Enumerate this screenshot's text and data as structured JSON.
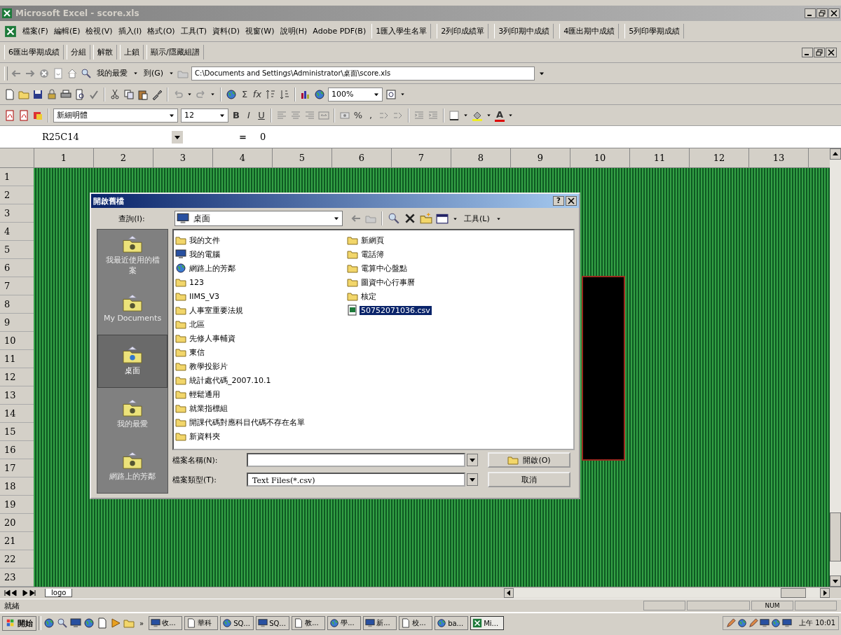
{
  "window": {
    "title": "Microsoft Excel - score.xls"
  },
  "menu_bar": {
    "items": [
      "檔案(F)",
      "編輯(E)",
      "檢視(V)",
      "插入(I)",
      "格式(O)",
      "工具(T)",
      "資料(D)",
      "視窗(W)",
      "說明(H)",
      "Adobe PDF(B)"
    ],
    "custom_buttons": [
      "1匯入學生名單",
      "2列印成績單",
      "3列印期中成績",
      "4匯出期中成績",
      "5列印學期成績"
    ]
  },
  "custom_toolbar": {
    "items": [
      "6匯出學期成績",
      "分組",
      "解散",
      "上鎖",
      "顯示/隱藏組譜"
    ]
  },
  "web_toolbar": {
    "favorites": "我的最愛",
    "go": "到(G)",
    "address": "C:\\Documents and Settings\\Administrator\\桌面\\score.xls"
  },
  "standard_toolbar": {
    "sum": "Σ",
    "function": "fx",
    "zoom": "100%"
  },
  "formatting_toolbar": {
    "font": "新細明體",
    "size": "12",
    "bold": "B",
    "italic": "I",
    "underline": "U",
    "percent": "%",
    "comma": ",",
    "font_color": "A"
  },
  "formula_bar": {
    "name_box": "R25C14",
    "equals": "=",
    "value": "0"
  },
  "sheet": {
    "columns": [
      "1",
      "2",
      "3",
      "4",
      "5",
      "6",
      "7",
      "8",
      "9",
      "10",
      "11",
      "12",
      "13"
    ],
    "rows": [
      "1",
      "2",
      "3",
      "4",
      "5",
      "6",
      "7",
      "8",
      "9",
      "10",
      "11",
      "12",
      "13",
      "14",
      "15",
      "16",
      "17",
      "18",
      "19",
      "20",
      "21",
      "22",
      "23"
    ]
  },
  "sheet_tabs": [
    {
      "label": "logo",
      "selected": true
    }
  ],
  "status_bar": {
    "mode": "就緒",
    "indicators": [
      "NUM"
    ]
  },
  "dialog": {
    "title": "開啟舊檔",
    "help": "?",
    "look_in_label": "查詢(I):",
    "look_in": "桌面",
    "tools": "工具(L)",
    "places": [
      {
        "label": "我最近使用的檔案",
        "selected": false
      },
      {
        "label": "My Documents",
        "selected": false
      },
      {
        "label": "桌面",
        "selected": true
      },
      {
        "label": "我的最愛",
        "selected": false
      },
      {
        "label": "網路上的芳鄰",
        "selected": false
      }
    ],
    "files": [
      {
        "name": "我的文件",
        "kind": "documents",
        "selected": false
      },
      {
        "name": "我的電腦",
        "kind": "computer",
        "selected": false
      },
      {
        "name": "網路上的芳鄰",
        "kind": "network",
        "selected": false
      },
      {
        "name": "123",
        "kind": "folder",
        "selected": false
      },
      {
        "name": "IIMS_V3",
        "kind": "folder",
        "selected": false
      },
      {
        "name": "人事室重要法規",
        "kind": "folder",
        "selected": false
      },
      {
        "name": "北區",
        "kind": "folder",
        "selected": false
      },
      {
        "name": "先修人事輔資",
        "kind": "folder",
        "selected": false
      },
      {
        "name": "東信",
        "kind": "folder",
        "selected": false
      },
      {
        "name": "教學投影片",
        "kind": "folder",
        "selected": false
      },
      {
        "name": "統計處代碼_2007.10.1",
        "kind": "folder",
        "selected": false
      },
      {
        "name": "輕鬆通用",
        "kind": "folder",
        "selected": false
      },
      {
        "name": "就業指標組",
        "kind": "folder",
        "selected": false
      },
      {
        "name": "開課代碼對應科目代碼不存在名單",
        "kind": "folder",
        "selected": false
      },
      {
        "name": "新資料夾",
        "kind": "folder",
        "selected": false
      },
      {
        "name": "新網頁",
        "kind": "folder",
        "selected": false
      },
      {
        "name": "電話簿",
        "kind": "folder",
        "selected": false
      },
      {
        "name": "電算中心盤點",
        "kind": "folder",
        "selected": false
      },
      {
        "name": "圖資中心行事曆",
        "kind": "folder",
        "selected": false
      },
      {
        "name": "核定",
        "kind": "folder",
        "selected": false
      },
      {
        "name": "50752071036.csv",
        "kind": "csv",
        "selected": true
      }
    ],
    "file_name_label": "檔案名稱(N):",
    "file_type_label": "檔案類型(T):",
    "file_type": "Text Files(*.csv)",
    "open_button": "開啟(O)",
    "cancel_button": "取消"
  },
  "taskbar": {
    "start": "開始",
    "more": "»",
    "tasks": [
      {
        "label": "收...",
        "selected": false
      },
      {
        "label": "華科",
        "selected": false
      },
      {
        "label": "SQ...",
        "selected": false
      },
      {
        "label": "SQ...",
        "selected": false
      },
      {
        "label": "教...",
        "selected": false
      },
      {
        "label": "學...",
        "selected": false
      },
      {
        "label": "新...",
        "selected": false
      },
      {
        "label": "校...",
        "selected": false
      },
      {
        "label": "ba...",
        "selected": false
      },
      {
        "label": "Mi...",
        "selected": true
      }
    ],
    "clock": "上午 10:01"
  }
}
